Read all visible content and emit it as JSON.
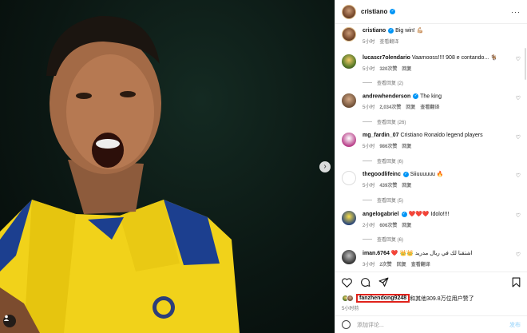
{
  "post": {
    "author": "cristiano",
    "caption_user": "cristiano",
    "caption_text": "Big win! 💪🏼",
    "caption_time": "5小时",
    "translate_label": "查看翻译"
  },
  "comments": [
    {
      "user": "lucascr7olendario",
      "text": "Vaamooss!!!! 908 e contando... 🐐",
      "time": "5小时",
      "likes": "320次赞",
      "reply": "回复",
      "view_replies": "查看回复 (2)",
      "avatar": "av-g"
    },
    {
      "user": "andrewhenderson",
      "text": "The king",
      "time": "5小时",
      "likes": "2,034次赞",
      "reply": "回复",
      "translate": "查看翻译",
      "view_replies": "查看回复 (26)",
      "avatar": "av-a",
      "verified": true
    },
    {
      "user": "mg_fardin_07",
      "text": "Cristiano Ronaldo legend players",
      "time": "5小时",
      "likes": "986次赞",
      "reply": "回复",
      "view_replies": "查看回复 (6)",
      "avatar": "av-m"
    },
    {
      "user": "thegoodlifeinc",
      "text": "Siiuuuuuu 🔥",
      "time": "5小时",
      "likes": "439次赞",
      "reply": "回复",
      "view_replies": "查看回复 (5)",
      "avatar": "av-t",
      "verified": true
    },
    {
      "user": "angelogabriel",
      "text": "❤️❤️❤️ Idolo!!!!",
      "time": "2小时",
      "likes": "606次赞",
      "reply": "回复",
      "view_replies": "查看回复 (6)",
      "avatar": "av-y",
      "verified": true
    },
    {
      "user": "iman.6764",
      "text": "❤️ 👑👑 اشتقنا لك في ريال مدريد",
      "time": "3小时",
      "likes": "2次赞",
      "reply": "回复",
      "translate": "查看翻译",
      "avatar": "av-i"
    }
  ],
  "likes_line": {
    "liker": "fanzhendong9248",
    "rest": "和其他309.8万位用户赞了"
  },
  "post_time": "5小时前",
  "compose": {
    "placeholder": "添加评论...",
    "post_label": "发布"
  },
  "icons": {
    "like": "heart-icon",
    "comment": "comment-icon",
    "share": "share-icon",
    "save": "bookmark-icon"
  }
}
